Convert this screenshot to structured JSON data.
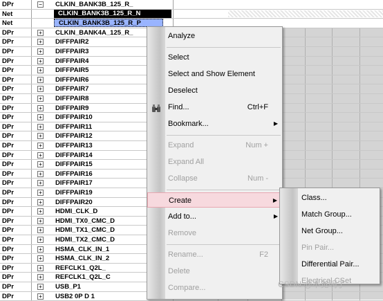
{
  "grid_rows": [
    {
      "type": "DPr",
      "expander": "−",
      "name": "CLKIN_BANK3B_125_R_",
      "style": "normal"
    },
    {
      "type": "Net",
      "expander": "",
      "name": "CLKIN_BANK3B_125_R_N",
      "style": "net-black"
    },
    {
      "type": "Net",
      "expander": "",
      "name": "CLKIN_BANK3B_125_R_P",
      "style": "net-blue"
    },
    {
      "type": "DPr",
      "expander": "+",
      "name": "CLKIN_BANK4A_125_R_",
      "style": "normal"
    },
    {
      "type": "DPr",
      "expander": "+",
      "name": "DIFFPAIR2",
      "style": "normal"
    },
    {
      "type": "DPr",
      "expander": "+",
      "name": "DIFFPAIR3",
      "style": "normal"
    },
    {
      "type": "DPr",
      "expander": "+",
      "name": "DIFFPAIR4",
      "style": "normal"
    },
    {
      "type": "DPr",
      "expander": "+",
      "name": "DIFFPAIR5",
      "style": "normal"
    },
    {
      "type": "DPr",
      "expander": "+",
      "name": "DIFFPAIR6",
      "style": "normal"
    },
    {
      "type": "DPr",
      "expander": "+",
      "name": "DIFFPAIR7",
      "style": "normal"
    },
    {
      "type": "DPr",
      "expander": "+",
      "name": "DIFFPAIR8",
      "style": "normal"
    },
    {
      "type": "DPr",
      "expander": "+",
      "name": "DIFFPAIR9",
      "style": "normal"
    },
    {
      "type": "DPr",
      "expander": "+",
      "name": "DIFFPAIR10",
      "style": "normal"
    },
    {
      "type": "DPr",
      "expander": "+",
      "name": "DIFFPAIR11",
      "style": "normal"
    },
    {
      "type": "DPr",
      "expander": "+",
      "name": "DIFFPAIR12",
      "style": "normal"
    },
    {
      "type": "DPr",
      "expander": "+",
      "name": "DIFFPAIR13",
      "style": "normal"
    },
    {
      "type": "DPr",
      "expander": "+",
      "name": "DIFFPAIR14",
      "style": "normal"
    },
    {
      "type": "DPr",
      "expander": "+",
      "name": "DIFFPAIR15",
      "style": "normal"
    },
    {
      "type": "DPr",
      "expander": "+",
      "name": "DIFFPAIR16",
      "style": "normal"
    },
    {
      "type": "DPr",
      "expander": "+",
      "name": "DIFFPAIR17",
      "style": "normal"
    },
    {
      "type": "DPr",
      "expander": "+",
      "name": "DIFFPAIR19",
      "style": "normal"
    },
    {
      "type": "DPr",
      "expander": "+",
      "name": "DIFFPAIR20",
      "style": "normal"
    },
    {
      "type": "DPr",
      "expander": "+",
      "name": "HDMI_CLK_D",
      "style": "normal"
    },
    {
      "type": "DPr",
      "expander": "+",
      "name": "HDMI_TX0_CMC_D",
      "style": "normal"
    },
    {
      "type": "DPr",
      "expander": "+",
      "name": "HDMI_TX1_CMC_D",
      "style": "normal"
    },
    {
      "type": "DPr",
      "expander": "+",
      "name": "HDMI_TX2_CMC_D",
      "style": "normal"
    },
    {
      "type": "DPr",
      "expander": "+",
      "name": "HSMA_CLK_IN_1",
      "style": "normal"
    },
    {
      "type": "DPr",
      "expander": "+",
      "name": "HSMA_CLK_IN_2",
      "style": "normal"
    },
    {
      "type": "DPr",
      "expander": "+",
      "name": "REFCLK1_Q2L_",
      "style": "normal"
    },
    {
      "type": "DPr",
      "expander": "+",
      "name": "REFCLK1_Q2L_C",
      "style": "normal"
    },
    {
      "type": "DPr",
      "expander": "+",
      "name": "USB_P1",
      "style": "normal"
    },
    {
      "type": "DPr",
      "expander": "+",
      "name": "USB2 0P D 1",
      "style": "normal"
    }
  ],
  "context_menu": {
    "items": [
      {
        "label": "Analyze",
        "shortcut": "",
        "enabled": true,
        "submenu": false,
        "icon": ""
      },
      {
        "sep": true
      },
      {
        "label": "Select",
        "shortcut": "",
        "enabled": true,
        "submenu": false,
        "icon": ""
      },
      {
        "label": "Select and Show Element",
        "shortcut": "",
        "enabled": true,
        "submenu": false,
        "icon": ""
      },
      {
        "label": "Deselect",
        "shortcut": "",
        "enabled": true,
        "submenu": false,
        "icon": ""
      },
      {
        "label": "Find...",
        "shortcut": "Ctrl+F",
        "enabled": true,
        "submenu": false,
        "icon": "binoculars-icon"
      },
      {
        "label": "Bookmark...",
        "shortcut": "",
        "enabled": true,
        "submenu": true,
        "icon": ""
      },
      {
        "sep": true
      },
      {
        "label": "Expand",
        "shortcut": "Num +",
        "enabled": false,
        "submenu": false,
        "icon": ""
      },
      {
        "label": "Expand All",
        "shortcut": "",
        "enabled": false,
        "submenu": false,
        "icon": ""
      },
      {
        "label": "Collapse",
        "shortcut": "Num -",
        "enabled": false,
        "submenu": false,
        "icon": ""
      },
      {
        "sep": true
      },
      {
        "label": "Create",
        "shortcut": "",
        "enabled": true,
        "submenu": true,
        "icon": "",
        "highlighted": true
      },
      {
        "label": "Add to...",
        "shortcut": "",
        "enabled": true,
        "submenu": true,
        "icon": ""
      },
      {
        "label": "Remove",
        "shortcut": "",
        "enabled": false,
        "submenu": false,
        "icon": ""
      },
      {
        "sep": true
      },
      {
        "label": "Rename...",
        "shortcut": "F2",
        "enabled": false,
        "submenu": false,
        "icon": ""
      },
      {
        "label": "Delete",
        "shortcut": "",
        "enabled": false,
        "submenu": false,
        "icon": ""
      },
      {
        "label": "Compare...",
        "shortcut": "",
        "enabled": false,
        "submenu": false,
        "icon": ""
      }
    ]
  },
  "create_submenu": {
    "items": [
      {
        "label": "Class...",
        "enabled": true
      },
      {
        "label": "Match Group...",
        "enabled": true
      },
      {
        "label": "Net Group...",
        "enabled": true
      },
      {
        "label": "Pin Pair...",
        "enabled": false
      },
      {
        "label": "Differential Pair...",
        "enabled": true
      },
      {
        "label": "Electrical CSet",
        "enabled": false
      }
    ]
  },
  "watermark": "CSDN @不觉明了"
}
